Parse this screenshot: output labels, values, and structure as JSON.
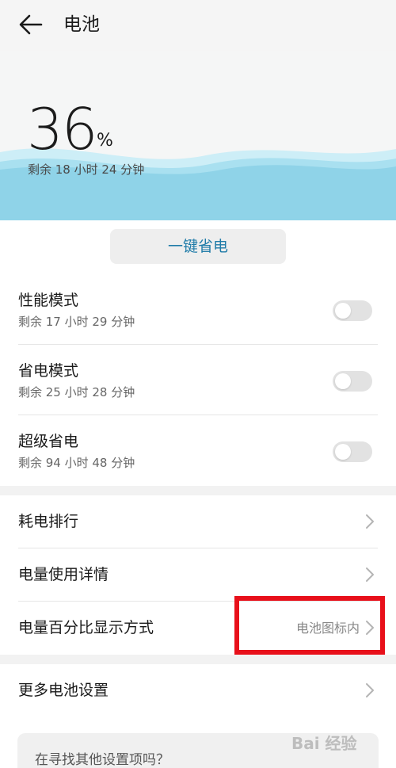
{
  "header": {
    "title": "电池",
    "back_icon": "arrow-left-icon"
  },
  "battery": {
    "percent": "36",
    "percent_unit": "%",
    "remaining": "剩余 18 小时 24 分钟",
    "wave_color": "#8fd3e8"
  },
  "one_key_save": {
    "label": "一键省电",
    "color": "#1f7ba8"
  },
  "modes": [
    {
      "title": "性能模式",
      "remaining": "剩余 17 小时 29 分钟",
      "enabled": false
    },
    {
      "title": "省电模式",
      "remaining": "剩余 25 小时 28 分钟",
      "enabled": false
    },
    {
      "title": "超级省电",
      "remaining": "剩余 94 小时 48 分钟",
      "enabled": false
    }
  ],
  "settings": [
    {
      "label": "耗电排行",
      "value": ""
    },
    {
      "label": "电量使用详情",
      "value": ""
    },
    {
      "label": "电量百分比显示方式",
      "value": "电池图标内"
    }
  ],
  "more": {
    "label": "更多电池设置"
  },
  "search_hint": "在寻找其他设置项吗？",
  "watermark": {
    "text": "Bai 经验"
  },
  "highlight_color": "#e8101a"
}
